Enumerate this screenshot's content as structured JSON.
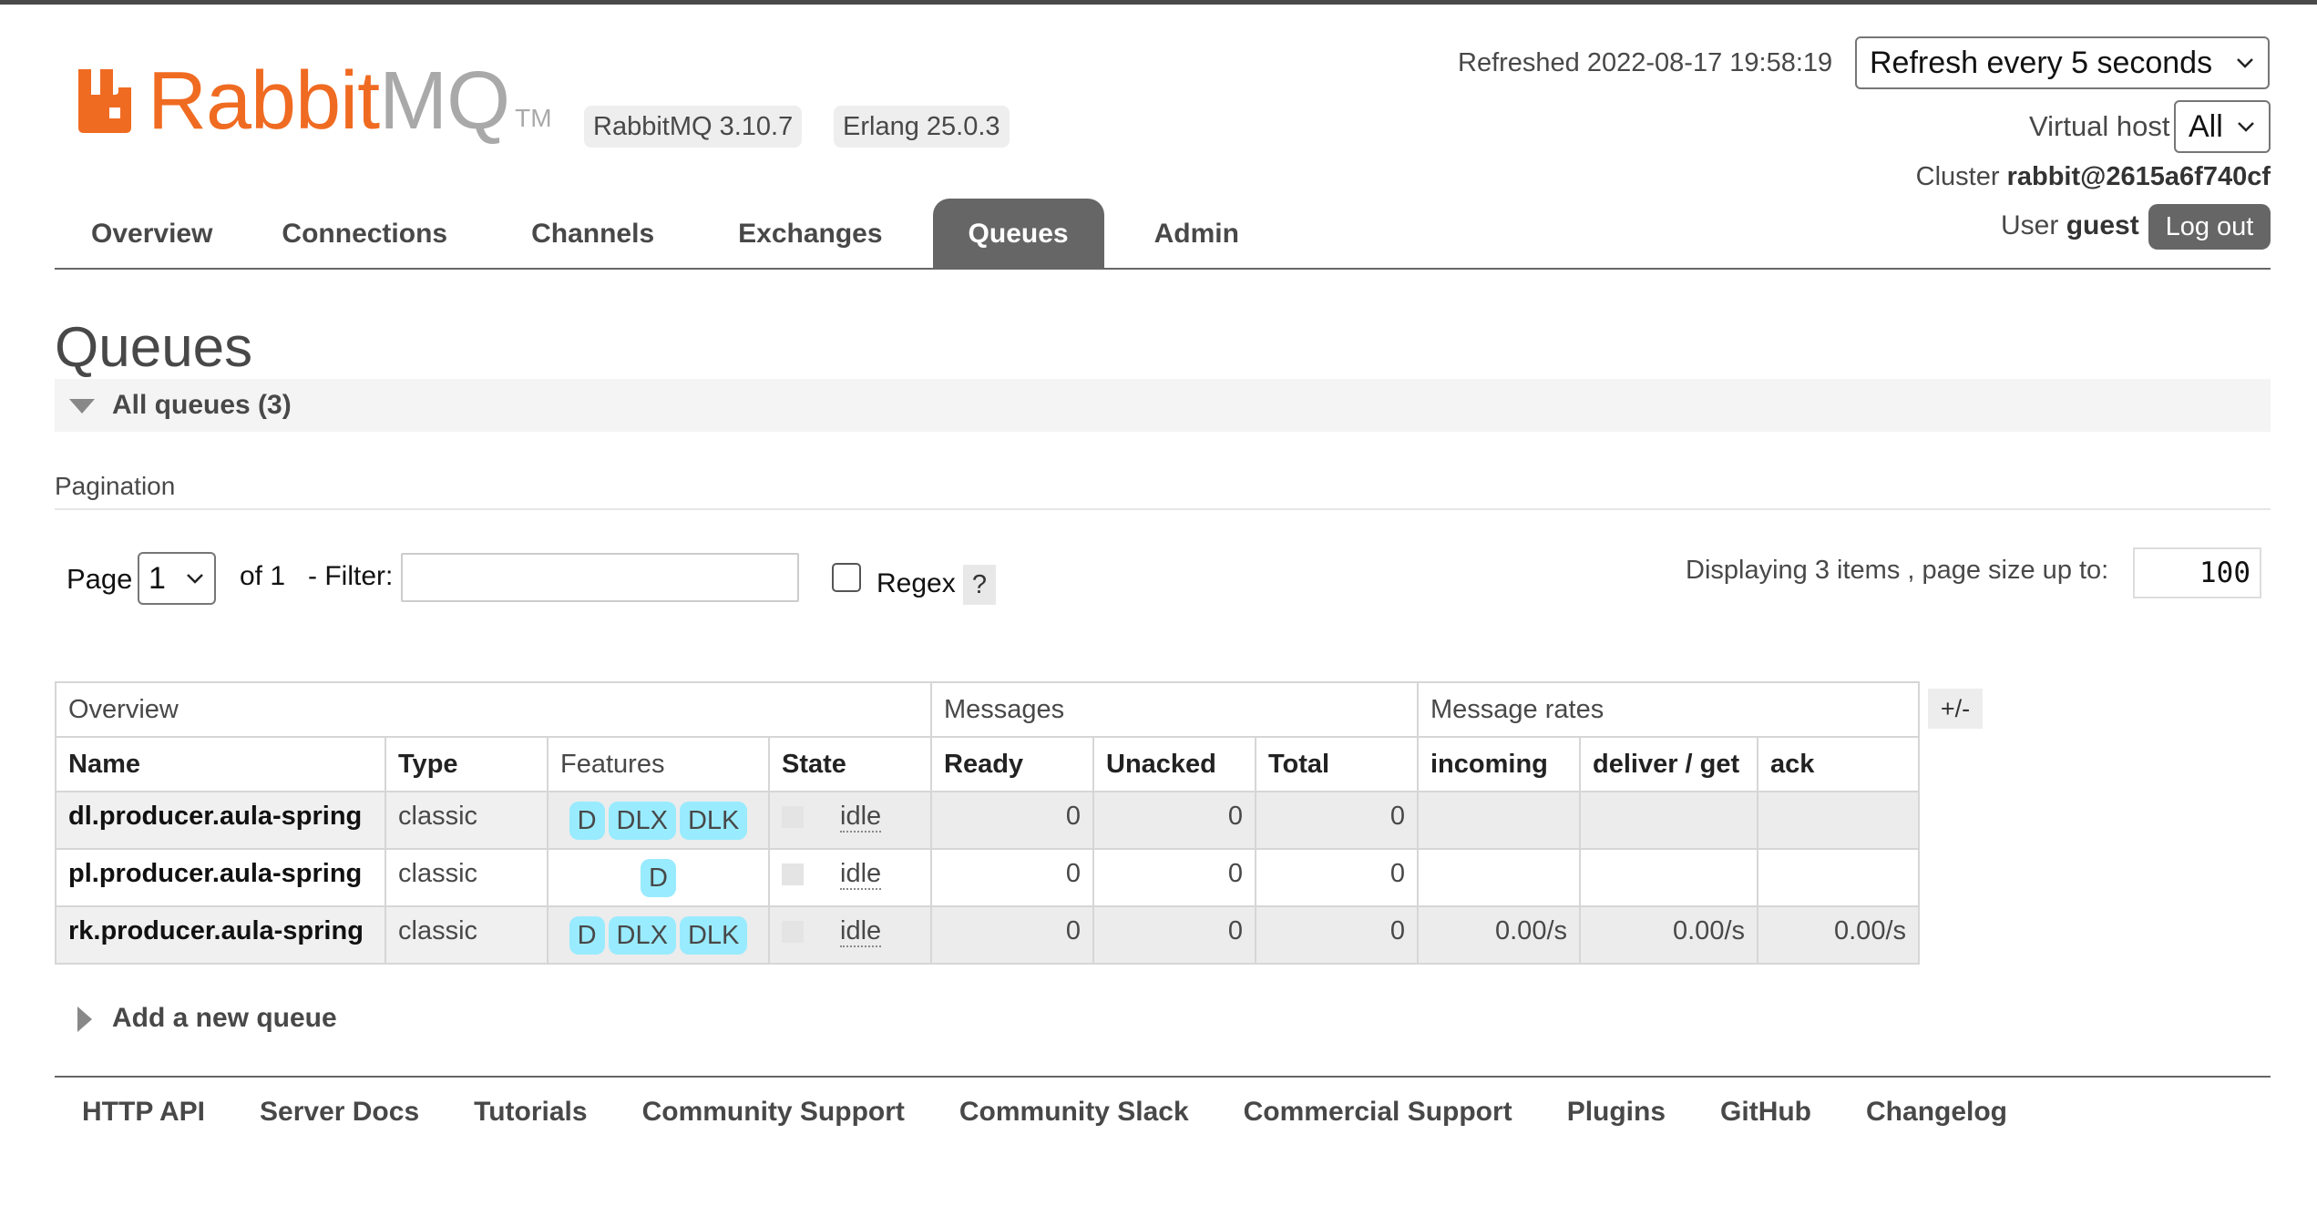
{
  "brand": {
    "logo_rabbit": "Rabbit",
    "logo_mq": "MQ",
    "logo_tm": "TM",
    "accent_color": "#f06b22",
    "rabbitmq_version": "RabbitMQ 3.10.7",
    "erlang_version": "Erlang 25.0.3"
  },
  "header": {
    "refreshed": "Refreshed 2022-08-17 19:58:19",
    "refresh_option": "Refresh every 5 seconds",
    "vhost_label": "Virtual host",
    "vhost_value": "All",
    "cluster_label": "Cluster",
    "cluster_name": "rabbit@2615a6f740cf",
    "user_label": "User",
    "user_name": "guest",
    "logout_label": "Log out"
  },
  "nav": {
    "tabs": [
      "Overview",
      "Connections",
      "Channels",
      "Exchanges",
      "Queues",
      "Admin"
    ],
    "active": "Queues"
  },
  "page": {
    "title": "Queues",
    "section_title": "All queues (3)",
    "pagination_label": "Pagination",
    "page_label": "Page",
    "page_value": "1",
    "of_label": "of 1",
    "filter_label": "- Filter:",
    "filter_value": "",
    "regex_label": "Regex",
    "help_label": "?",
    "displaying": "Displaying 3 items , page size up to:",
    "page_size": "100"
  },
  "table": {
    "groups": [
      "Overview",
      "Messages",
      "Message rates"
    ],
    "plusminus": "+/-",
    "columns": [
      "Name",
      "Type",
      "Features",
      "State",
      "Ready",
      "Unacked",
      "Total",
      "incoming",
      "deliver / get",
      "ack"
    ],
    "rows": [
      {
        "name": "dl.producer.aula-spring",
        "type": "classic",
        "features": [
          "D",
          "DLX",
          "DLK"
        ],
        "state": "idle",
        "ready": "0",
        "unacked": "0",
        "total": "0",
        "incoming": "",
        "deliver_get": "",
        "ack": ""
      },
      {
        "name": "pl.producer.aula-spring",
        "type": "classic",
        "features": [
          "D"
        ],
        "state": "idle",
        "ready": "0",
        "unacked": "0",
        "total": "0",
        "incoming": "",
        "deliver_get": "",
        "ack": ""
      },
      {
        "name": "rk.producer.aula-spring",
        "type": "classic",
        "features": [
          "D",
          "DLX",
          "DLK"
        ],
        "state": "idle",
        "ready": "0",
        "unacked": "0",
        "total": "0",
        "incoming": "0.00/s",
        "deliver_get": "0.00/s",
        "ack": "0.00/s"
      }
    ]
  },
  "add_queue": "Add a new queue",
  "footer": {
    "links": [
      "HTTP API",
      "Server Docs",
      "Tutorials",
      "Community Support",
      "Community Slack",
      "Commercial Support",
      "Plugins",
      "GitHub",
      "Changelog"
    ]
  }
}
